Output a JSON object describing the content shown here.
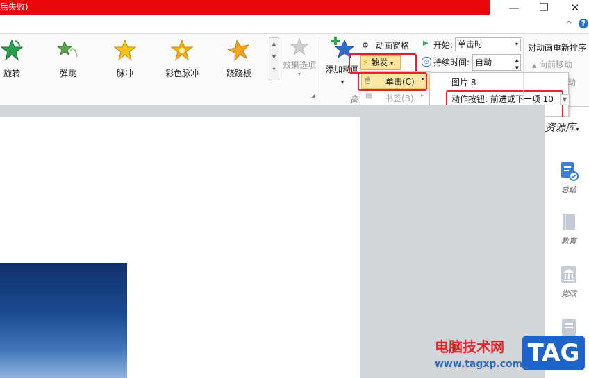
{
  "title_bar": {
    "title_fragment": "后失败)"
  },
  "window_controls": {
    "minimize": "—",
    "restore": "❐",
    "close": "✕"
  },
  "help": {
    "collapse": "^",
    "help": "?"
  },
  "animation_gallery": [
    {
      "label": "旋转",
      "color": "#2e9e4f"
    },
    {
      "label": "弹跳",
      "color": "#5aa84a"
    },
    {
      "label": "脉冲",
      "color": "#f2c21a"
    },
    {
      "label": "彩色脉冲",
      "color": "#f0b01a"
    },
    {
      "label": "跷跷板",
      "color": "#f5a623"
    }
  ],
  "effect_options": {
    "label": "效果选项"
  },
  "add_animation": {
    "label": "添加动画",
    "group_label": "高"
  },
  "animation_pane": {
    "label": "动画窗格"
  },
  "trigger": {
    "label": "触发",
    "arrow": "▾"
  },
  "trigger_menu": [
    {
      "label": "单击(C)",
      "state": "selected"
    },
    {
      "label": "书签(B)",
      "state": "disabled"
    }
  ],
  "trigger_submenu": [
    {
      "label": "图片 8"
    },
    {
      "label": "动作按钮: 前进或下一项 10"
    }
  ],
  "timing": {
    "start_label": "开始:",
    "start_value": "单击时",
    "duration_label": "持续时间:",
    "duration_value": "自动"
  },
  "reorder": {
    "title": "对动画重新排序",
    "move_earlier": "向前移动",
    "move_later": "动"
  },
  "sidebar": {
    "title": "资源库",
    "items": [
      {
        "label": "总结",
        "color": "#3c7fd9"
      },
      {
        "label": "教育",
        "color": "#c5cbd6"
      },
      {
        "label": "党政",
        "color": "#c5cbd6"
      },
      {
        "label": "",
        "color": "#c5cbd6"
      }
    ]
  },
  "watermark": {
    "site_name": "电脑技术网",
    "url": "www.tagxp.com",
    "badge": "TAG"
  }
}
